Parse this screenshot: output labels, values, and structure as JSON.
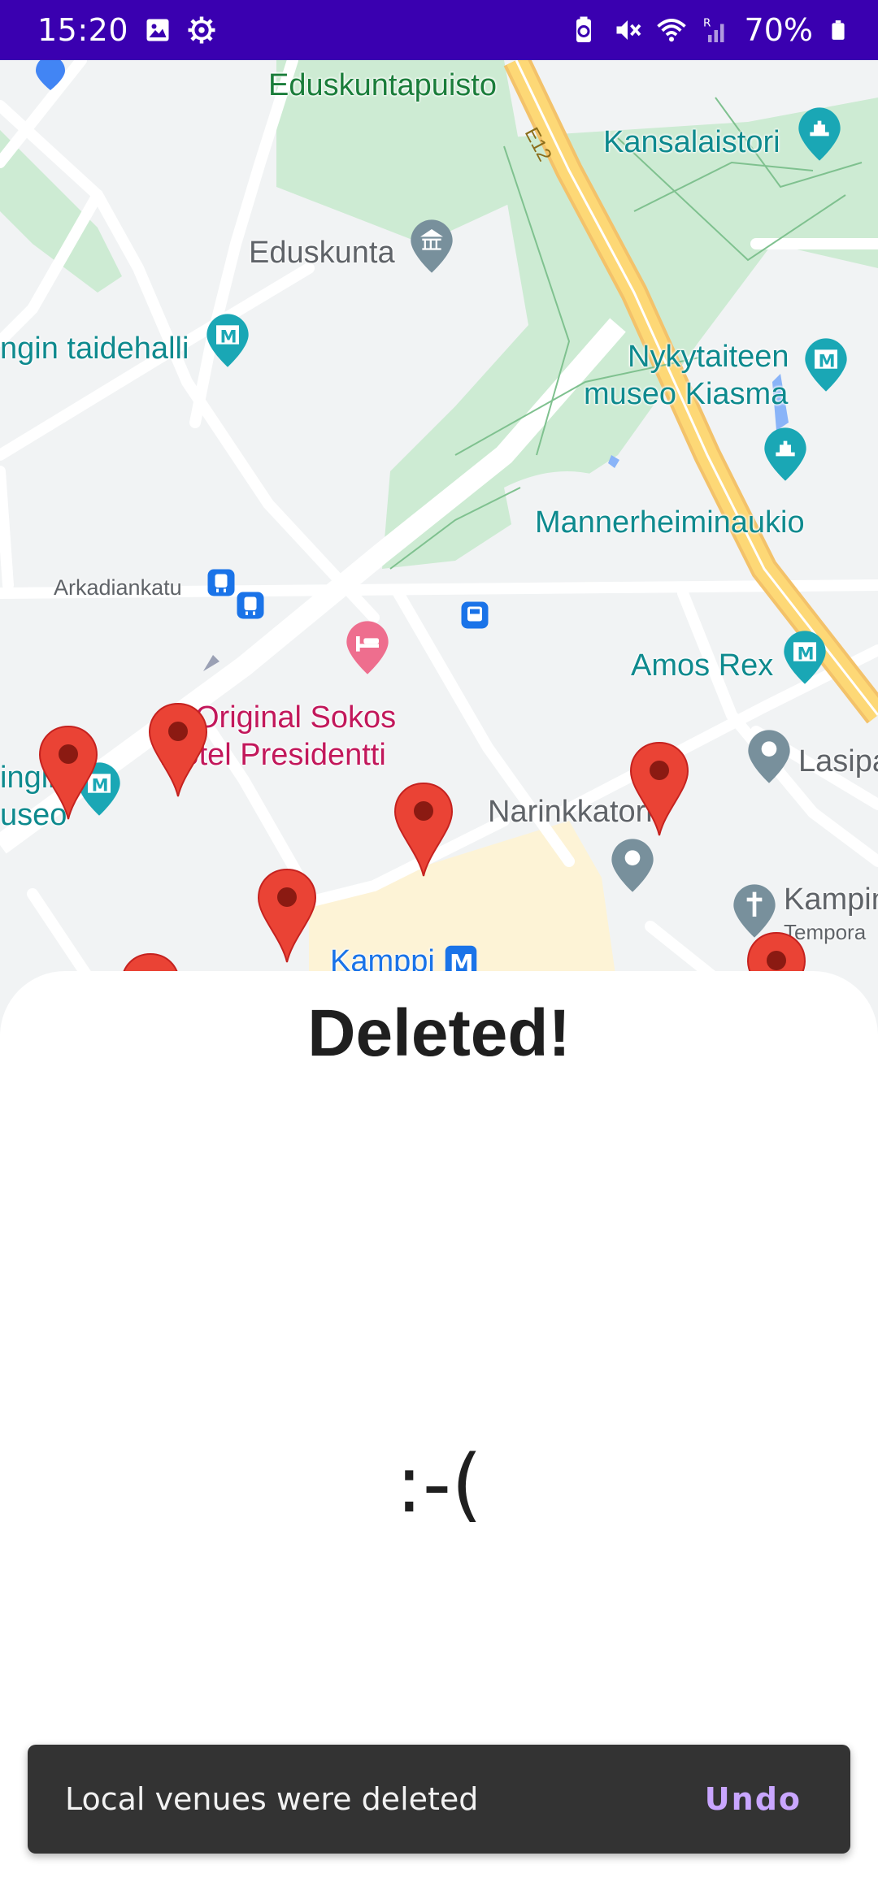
{
  "status_bar": {
    "time": "15:20",
    "battery": "70%",
    "icons_left": [
      "gallery-icon",
      "settings-gear-icon"
    ],
    "icons_right": [
      "battery-saver-icon",
      "mute-icon",
      "wifi-icon",
      "signal-roaming-icon",
      "battery-icon"
    ]
  },
  "map": {
    "labels": {
      "eduskuntapuisto": "Eduskuntapuisto",
      "kansalaistori": "Kansalaistori",
      "eduskunta": "Eduskunta",
      "taidehalli": "ngin taidehalli",
      "kiasma_1": "Nykytaiteen",
      "kiasma_2": "museo Kiasma",
      "mannerheiminaukio": "Mannerheiminaukio",
      "arkadiankatu": "Arkadiankatu",
      "amos_rex": "Amos Rex",
      "sokos_1": "Original Sokos",
      "sokos_2": "Hotel Presidentti",
      "museo_1": "ingin",
      "museo_2": "useo",
      "narinkkatori": "Narinkkatori",
      "lasipalatsi": "Lasipa",
      "kampin": "Kampin",
      "temporary": "Tempora",
      "kamppi": "Kamppi",
      "e12": "E12"
    },
    "road_color": "#fdd876",
    "park_color": "#cdebd3",
    "marker_color": "#ea4335"
  },
  "sheet": {
    "title": "Deleted!",
    "face": ":-("
  },
  "snackbar": {
    "message": "Local venues were deleted",
    "action": "Undo"
  }
}
